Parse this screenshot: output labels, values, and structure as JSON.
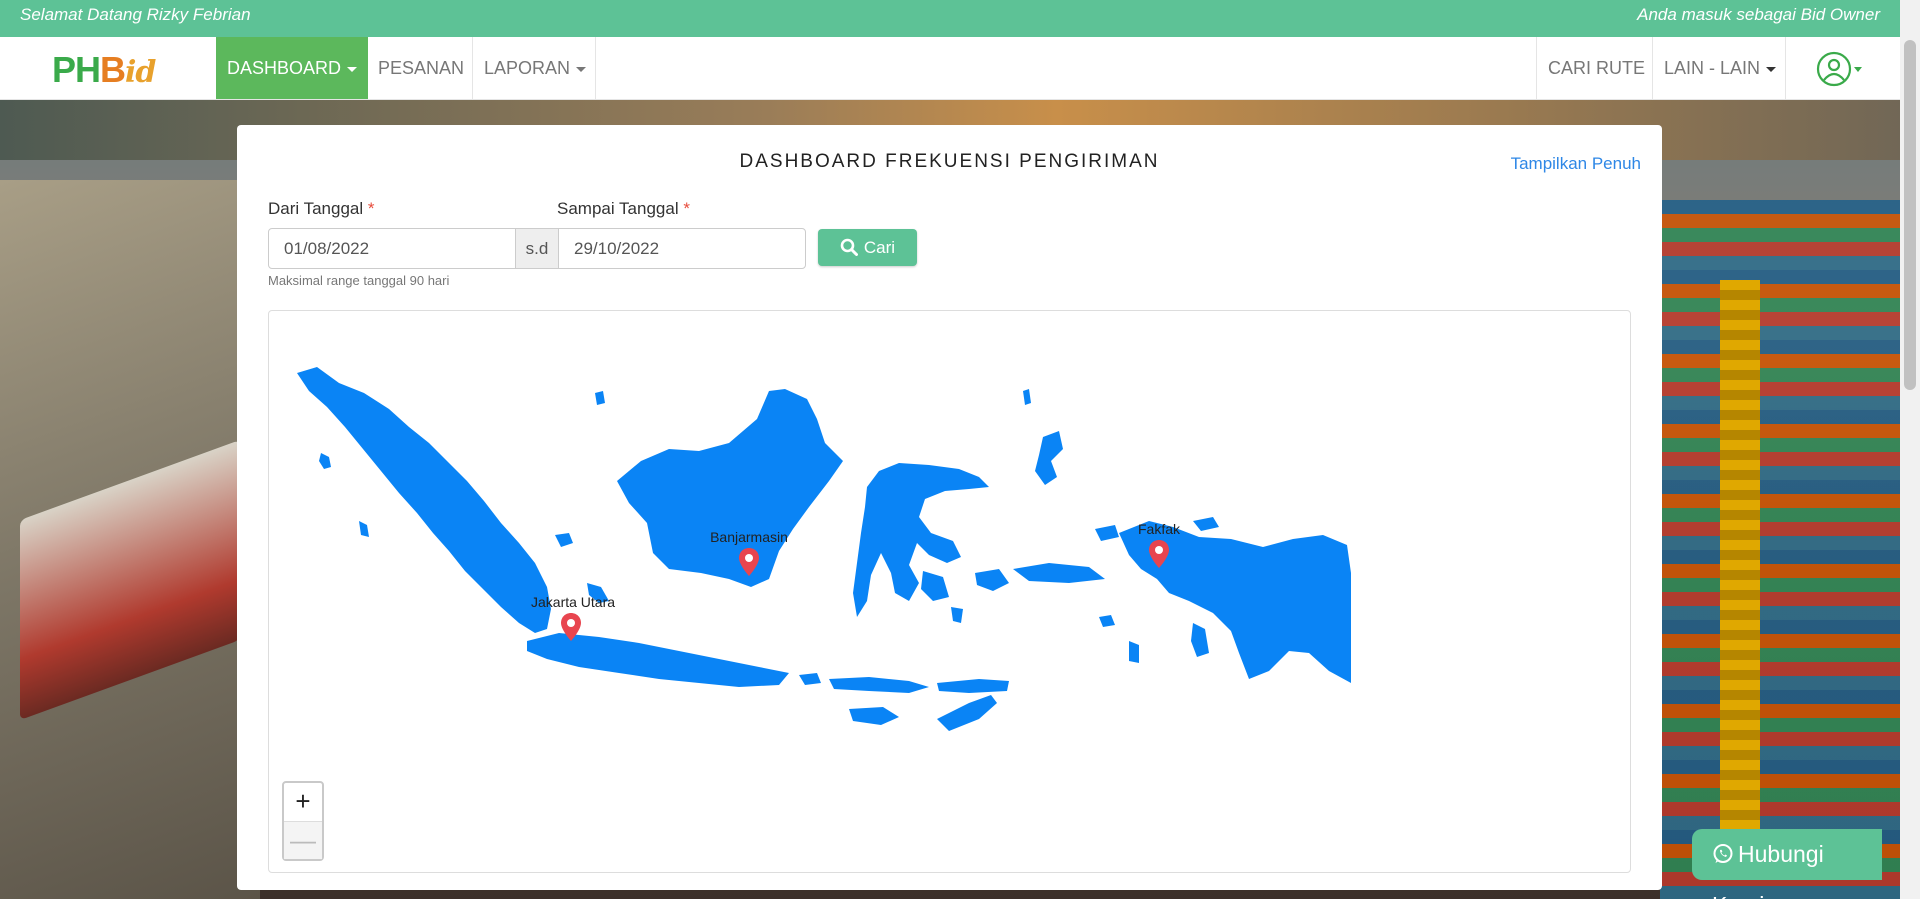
{
  "topbar": {
    "welcome": "Selamat Datang Rizky Febrian",
    "role": "Anda masuk sebagai Bid Owner"
  },
  "navbar": {
    "logo": {
      "ph": "PH",
      "b": "B",
      "id": "id"
    },
    "items": [
      {
        "label": "DASHBOARD",
        "active": true,
        "dropdown": true
      },
      {
        "label": "PESANAN",
        "active": false,
        "dropdown": false
      },
      {
        "label": "LAPORAN",
        "active": false,
        "dropdown": true
      }
    ],
    "right_items": [
      {
        "label": "CARI RUTE",
        "dropdown": false
      },
      {
        "label": "LAIN - LAIN",
        "dropdown": true
      }
    ],
    "profile_icon": "user-circle-icon"
  },
  "dashboard": {
    "title": "DASHBOARD FREKUENSI PENGIRIMAN",
    "fullscreen_link": "Tampilkan Penuh",
    "from_label": "Dari Tanggal",
    "to_label": "Sampai Tanggal",
    "required_mark": "*",
    "from_value": "01/08/2022",
    "to_value": "29/10/2022",
    "separator": "s.d",
    "search_button": "Cari",
    "hint": "Maksimal range tanggal 90 hari"
  },
  "map": {
    "fill_color": "#0a84f5",
    "markers": [
      {
        "label": "Jakarta Utara"
      },
      {
        "label": "Banjarmasin"
      },
      {
        "label": "Fakfak"
      }
    ],
    "zoom_in": "+",
    "zoom_out": "—"
  },
  "whatsapp": {
    "label": "Hubungi Kami"
  },
  "colors": {
    "accent": "#5dc296",
    "active_nav": "#5cb85c",
    "link": "#2e87e6",
    "marker": "#e8454f"
  }
}
